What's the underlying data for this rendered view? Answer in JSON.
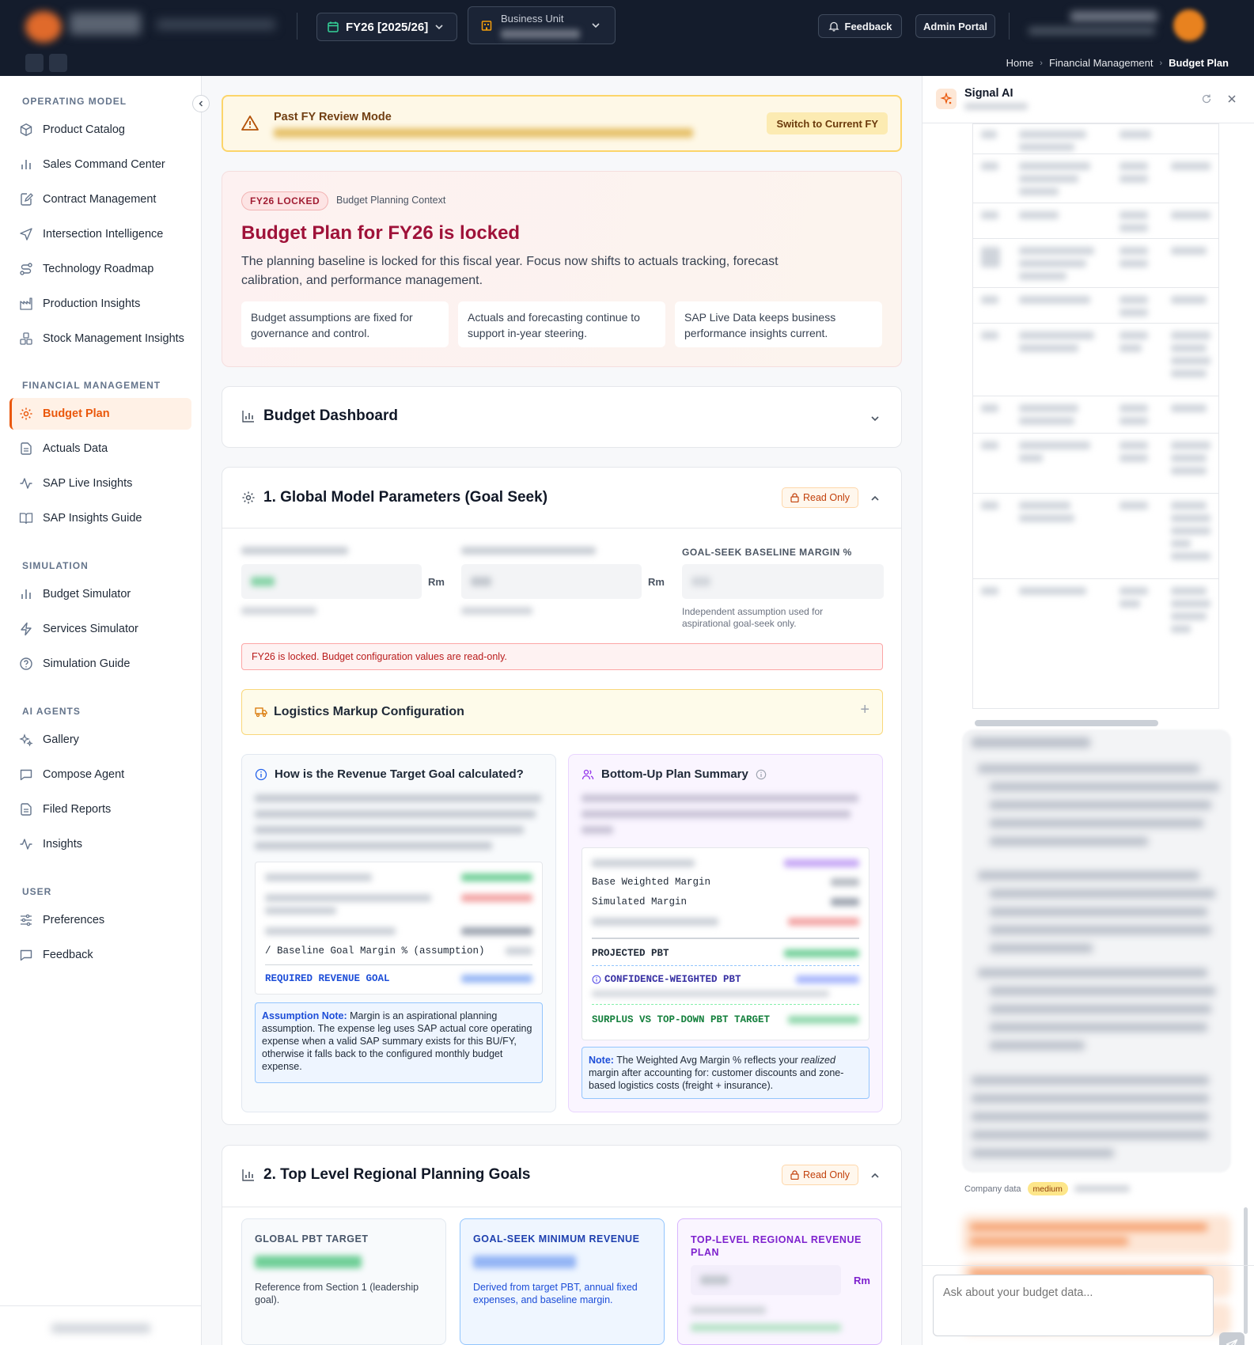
{
  "header": {
    "fiscal_year": "FY26 [2025/26]",
    "business_unit_label": "Business Unit",
    "feedback_label": "Feedback",
    "admin_portal_label": "Admin Portal",
    "breadcrumbs": [
      "Home",
      "Financial Management",
      "Budget Plan"
    ]
  },
  "sidebar": {
    "sections": [
      {
        "title": "OPERATING MODEL",
        "items": [
          "Product Catalog",
          "Sales Command Center",
          "Contract Management",
          "Intersection Intelligence",
          "Technology Roadmap",
          "Production Insights",
          "Stock Management Insights"
        ]
      },
      {
        "title": "FINANCIAL MANAGEMENT",
        "items": [
          "Budget Plan",
          "Actuals Data",
          "SAP Live Insights",
          "SAP Insights Guide"
        ]
      },
      {
        "title": "SIMULATION",
        "items": [
          "Budget Simulator",
          "Services Simulator",
          "Simulation Guide"
        ]
      },
      {
        "title": "AI AGENTS",
        "items": [
          "Gallery",
          "Compose Agent",
          "Filed Reports",
          "Insights"
        ]
      },
      {
        "title": "USER",
        "items": [
          "Preferences",
          "Feedback"
        ]
      }
    ],
    "active_item": "Budget Plan"
  },
  "banner": {
    "title": "Past FY Review Mode",
    "button": "Switch to Current FY"
  },
  "locked": {
    "pill": "FY26 LOCKED",
    "context": "Budget Planning Context",
    "title": "Budget Plan for FY26 is locked",
    "description": "The planning baseline is locked for this fiscal year. Focus now shifts to actuals tracking, forecast calibration, and performance management.",
    "cards": [
      "Budget assumptions are fixed for governance and control.",
      "Actuals and forecasting continue to support in-year steering.",
      "SAP Live Data keeps business performance insights current."
    ]
  },
  "dashboard": {
    "title": "Budget Dashboard"
  },
  "section1": {
    "title": "1. Global Model Parameters (Goal Seek)",
    "read_only": "Read Only",
    "unit": "Rm",
    "margin_label": "GOAL-SEEK BASELINE MARGIN %",
    "margin_help": "Independent assumption used for aspirational goal-seek only.",
    "alert": "FY26 is locked. Budget configuration values are read-only.",
    "logistics_title": "Logistics Markup Configuration",
    "revenue_box": {
      "title": "How is the Revenue Target Goal calculated?",
      "row_baseline": "/ Baseline Goal Margin % (assumption)",
      "row_required": "REQUIRED REVENUE GOAL",
      "note_label": "Assumption Note:",
      "note_text": " Margin is an aspirational planning assumption. The expense leg uses SAP actual core operating expense when a valid SAP summary exists for this BU/FY, otherwise it falls back to the configured monthly budget expense."
    },
    "bottomup_box": {
      "title": "Bottom-Up Plan Summary",
      "row_base": "Base Weighted Margin",
      "row_sim": "Simulated Margin",
      "row_pbt": "PROJECTED PBT",
      "row_conf": "CONFIDENCE-WEIGHTED PBT",
      "row_surplus": "SURPLUS VS TOP-DOWN PBT TARGET",
      "note_label": "Note:",
      "note_a": " The Weighted Avg Margin % reflects your ",
      "note_em": "realized",
      "note_b": " margin after accounting for: customer discounts and zone-based logistics costs (freight + insurance)."
    }
  },
  "section2": {
    "title": "2. Top Level Regional Planning Goals",
    "read_only": "Read Only",
    "tiles": [
      {
        "title": "GLOBAL PBT TARGET",
        "desc": "Reference from Section 1 (leadership goal)."
      },
      {
        "title": "GOAL-SEEK MINIMUM REVENUE",
        "desc": "Derived from target PBT, annual fixed expenses, and baseline margin."
      },
      {
        "title": "TOP-LEVEL REGIONAL REVENUE PLAN",
        "unit": "Rm"
      }
    ]
  },
  "ai": {
    "title": "Signal AI",
    "meta_source": "Company data",
    "meta_confidence": "medium",
    "input_placeholder": "Ask about your budget data..."
  },
  "colors": {
    "accent": "#ea580c",
    "topbar": "#141c2c",
    "locked_title": "#9f1239"
  }
}
